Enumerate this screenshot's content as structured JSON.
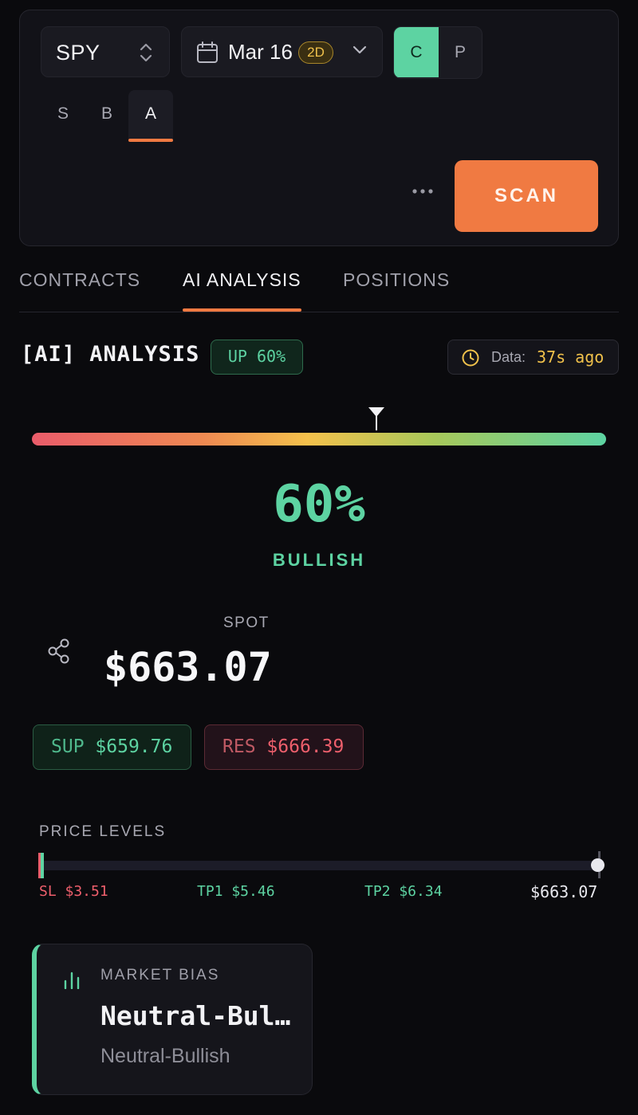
{
  "controls": {
    "symbol": "SPY",
    "date": "Mar 16",
    "dte_badge": "2D",
    "call_label": "C",
    "put_label": "P",
    "modes": [
      "S",
      "B",
      "A"
    ],
    "active_mode": "A",
    "scan_label": "SCAN"
  },
  "tabs": [
    {
      "label": "CONTRACTS",
      "active": false
    },
    {
      "label": "AI ANALYSIS",
      "active": true
    },
    {
      "label": "POSITIONS",
      "active": false
    }
  ],
  "analysis": {
    "title": "[AI] ANALYSIS",
    "direction_badge": "UP 60%",
    "data_label": "Data:",
    "data_age": "37s ago",
    "confidence_value": 0.6,
    "confidence_text": "60%",
    "bias_word": "BULLISH",
    "spot_label": "SPOT",
    "spot_value": "$663.07",
    "support_label": "SUP",
    "support_value": "$659.76",
    "resistance_label": "RES",
    "resistance_value": "$666.39"
  },
  "price_levels": {
    "label": "PRICE LEVELS",
    "sl": "SL $3.51",
    "tp1": "TP1 $5.46",
    "tp2": "TP2 $6.34",
    "spot": "$663.07"
  },
  "market_bias": {
    "label": "MARKET BIAS",
    "value": "Neutral-Bullish",
    "sub": "Neutral-Bullish"
  },
  "colors": {
    "accent": "#f07a42",
    "bullish": "#5dd3a2",
    "bearish": "#ee5f6c",
    "warning": "#f0c14b"
  }
}
